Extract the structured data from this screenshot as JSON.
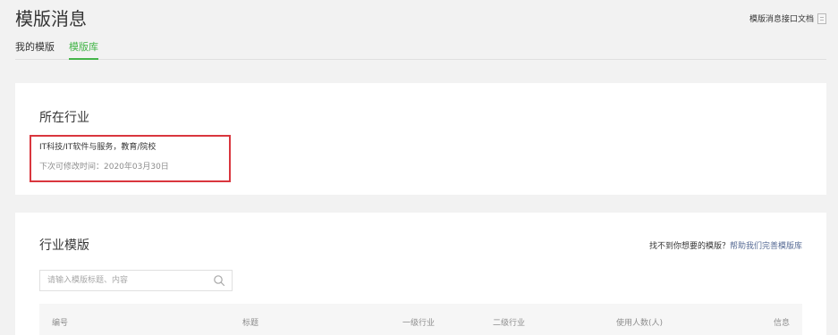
{
  "header": {
    "title": "模版消息",
    "doc_link": "模版消息接口文档"
  },
  "tabs": [
    {
      "label": "我的模版",
      "active": false
    },
    {
      "label": "模版库",
      "active": true
    }
  ],
  "industry": {
    "title": "所在行业",
    "value": "IT科技/IT软件与服务，教育/院校",
    "next_change": "下次可修改时间：2020年03月30日"
  },
  "templates": {
    "title": "行业模版",
    "help_prefix": "找不到你想要的模版？",
    "help_link": "帮助我们完善模版库",
    "search_placeholder": "请输入模版标题、内容",
    "columns": [
      "编号",
      "标题",
      "一级行业",
      "二级行业",
      "使用人数(人)",
      "信息"
    ]
  },
  "colors": {
    "accent": "#44b549",
    "link": "#576b95",
    "highlight": "#d9363e"
  }
}
